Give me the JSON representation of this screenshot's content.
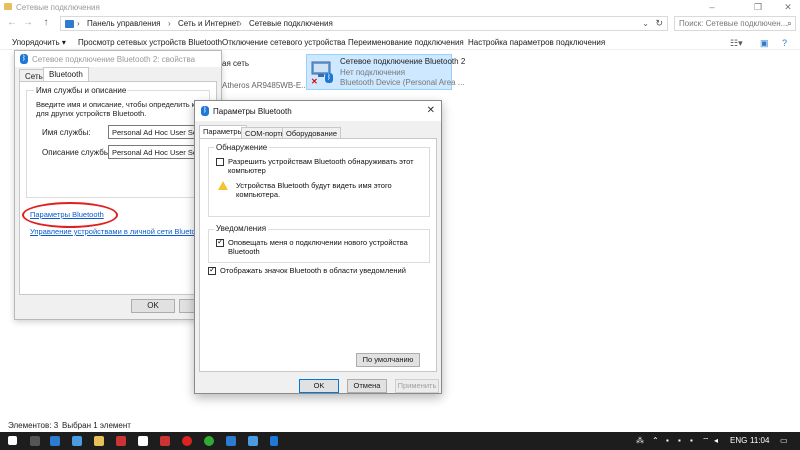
{
  "window": {
    "title": "Сетевые подключения",
    "minimize": "–",
    "maximize": "❐",
    "close": "✕"
  },
  "nav": {
    "back": "←",
    "forward": "→",
    "up": "↑"
  },
  "address": {
    "crumbs": [
      "Панель управления",
      "Сеть и Интернет",
      "Сетевые подключения"
    ],
    "separator": "›",
    "search_placeholder": "Поиск: Сетевые подключен..."
  },
  "commands": {
    "organize": "Упорядочить ▾",
    "view_devices": "Просмотр сетевых устройств Bluetooth",
    "disconnect": "Отключение сетевого устройства",
    "rename": "Переименование подключения",
    "settings": "Настройка параметров подключения"
  },
  "items": {
    "left_line1": "ая сеть",
    "left_line2": "Atheros AR9485WB-E...",
    "selected": {
      "name": "Сетевое подключение Bluetooth 2",
      "status": "Нет подключения",
      "device": "Bluetooth Device (Personal Area ..."
    }
  },
  "status": {
    "count": "Элементов: 3",
    "selected": "Выбран 1 элемент"
  },
  "props_dialog": {
    "title": "Сетевое подключение Bluetooth 2: свойства",
    "tabs": [
      "Сеть",
      "Bluetooth"
    ],
    "group_title": "Имя службы и описание",
    "desc_line1": "Введите имя и описание, чтобы определить компьютер",
    "desc_line2": "для других устройств Bluetooth.",
    "service_name_label": "Имя службы:",
    "service_name_value": "Personal Ad Hoc User Service",
    "service_desc_label": "Описание службы:",
    "service_desc_value": "Personal Ad Hoc User Service",
    "link_params": "Параметры Bluetooth",
    "link_manage": "Управление устройствами в личной сети Bluetooth",
    "ok": "OK",
    "cancel": "О"
  },
  "bt_dialog": {
    "title": "Параметры Bluetooth",
    "close": "✕",
    "tabs": [
      "Параметры",
      "COM-порты",
      "Оборудование"
    ],
    "discovery_title": "Обнаружение",
    "discovery_cb_line1": "Разрешить устройствам Bluetooth обнаруживать этот",
    "discovery_cb_line2": "компьютер",
    "discovery_checked": false,
    "warning_line1": "Устройства Bluetooth будут видеть имя этого",
    "warning_line2": "компьютера.",
    "notify_title": "Уведомления",
    "notify_cb_line1": "Оповещать меня о подключении нового устройства",
    "notify_cb_line2": "Bluetooth",
    "notify_checked": true,
    "tray_cb": "Отображать значок Bluetooth в области уведомлений",
    "tray_checked": true,
    "default_btn": "По умолчанию",
    "ok": "OK",
    "cancel": "Отмена",
    "apply": "Применить"
  },
  "taskbar": {
    "lang": "ENG",
    "time": "11:04"
  },
  "colors": {
    "accent": "#0078d7",
    "selection_bg": "#cde8ff",
    "annotation_red": "#e02020",
    "taskbar": "#1d1d1d"
  }
}
